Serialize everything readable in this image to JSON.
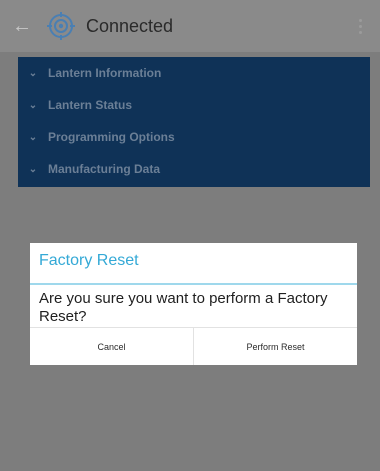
{
  "app_bar": {
    "title": "Connected",
    "back_icon": "arrow-back-icon",
    "app_icon": "target-icon",
    "overflow_icon": "more-vertical-icon"
  },
  "menu": {
    "items": [
      {
        "label": "Lantern Information",
        "icon": "chevron-down-icon"
      },
      {
        "label": "Lantern Status",
        "icon": "chevron-down-icon"
      },
      {
        "label": "Programming Options",
        "icon": "chevron-down-icon"
      },
      {
        "label": "Manufacturing Data",
        "icon": "chevron-down-icon"
      }
    ]
  },
  "dialog": {
    "title": "Factory Reset",
    "message": "Are you sure you want to perform a Factory Reset?",
    "cancel_label": "Cancel",
    "confirm_label": "Perform Reset"
  },
  "colors": {
    "menu_background": "#0f3257",
    "dialog_title": "#34a9d6",
    "scrim": "#7d7d7d"
  }
}
